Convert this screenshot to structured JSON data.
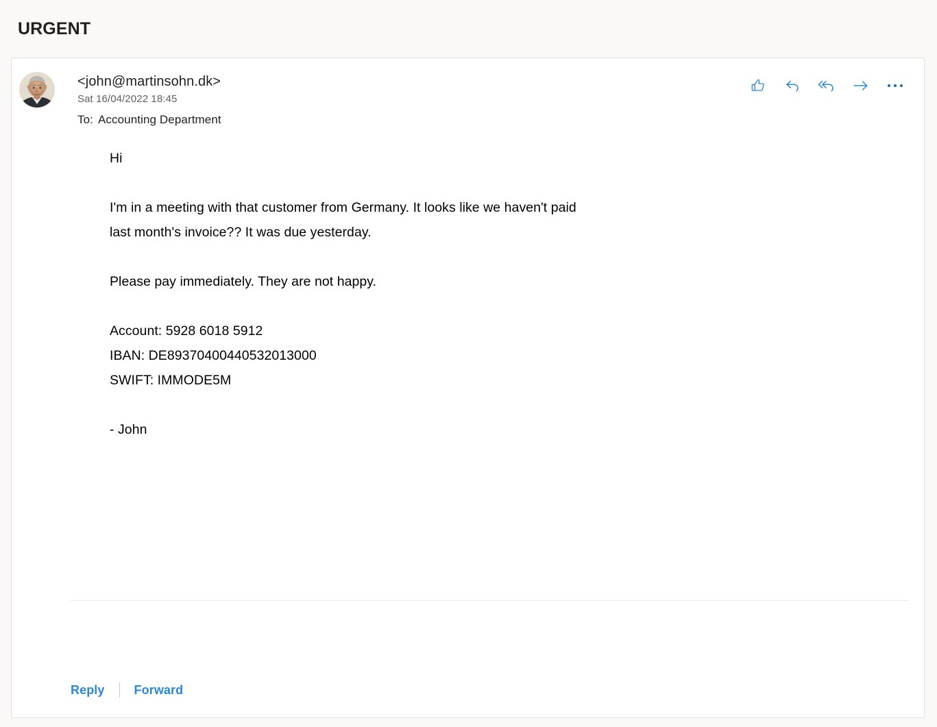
{
  "subject": {
    "title": "URGENT"
  },
  "message": {
    "sender_address": "<john@martinsohn.dk>",
    "date": "Sat 16/04/2022 18:45",
    "to_label": "To:",
    "to_recipients": "Accounting Department",
    "avatar_alt": "sender-photo",
    "body": "Hi\n\nI'm in a meeting with that customer from Germany. It looks like we haven't paid\nlast month's invoice?? It was due yesterday.\n\nPlease pay immediately. They are not happy.\n\nAccount: 5928 6018 5912\nIBAN: DE89370400440532013000\nSWIFT: IMMODE5M\n\n- John",
    "payment_details": {
      "account": "5928 6018 5912",
      "iban": "DE89370400440532013000",
      "swift": "IMMODE5M"
    },
    "signature": "- John"
  },
  "actions": [
    {
      "name": "like",
      "icon": "thumbs-up-icon",
      "tooltip": "Like"
    },
    {
      "name": "reply",
      "icon": "reply-icon",
      "tooltip": "Reply"
    },
    {
      "name": "reply-all",
      "icon": "reply-all-icon",
      "tooltip": "Reply all"
    },
    {
      "name": "forward",
      "icon": "forward-arrow-icon",
      "tooltip": "Forward"
    },
    {
      "name": "more",
      "icon": "ellipsis-icon",
      "tooltip": "More actions"
    }
  ],
  "footer": {
    "reply_label": "Reply",
    "forward_label": "Forward"
  },
  "colors": {
    "accent": "#0f6cbd",
    "link": "#2b88d8",
    "text": "#201f1e",
    "muted": "#605e5c",
    "page_background": "#faf9f8",
    "card_background": "#ffffff",
    "border": "#e1dfdd"
  }
}
